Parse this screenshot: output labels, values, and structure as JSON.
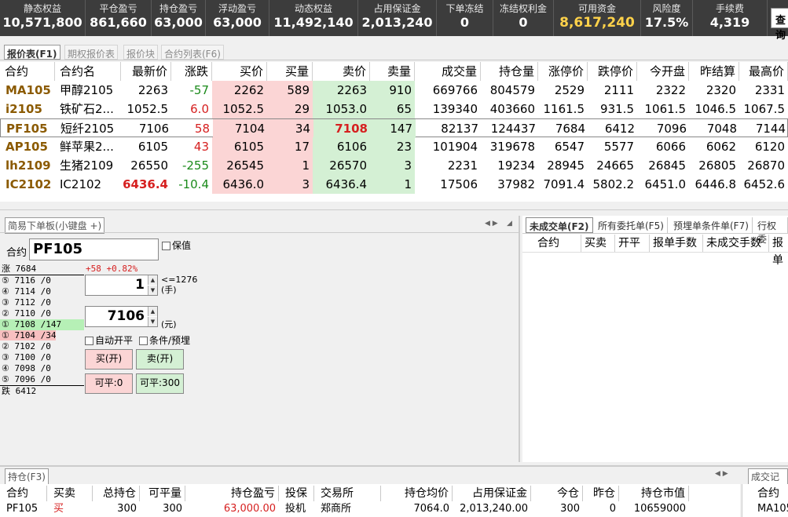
{
  "topbar": [
    {
      "label": "静态权益",
      "value": "10,571,800"
    },
    {
      "label": "平仓盈亏",
      "value": "861,660"
    },
    {
      "label": "持仓盈亏",
      "value": "63,000"
    },
    {
      "label": "浮动盈亏",
      "value": "63,000"
    },
    {
      "label": "动态权益",
      "value": "11,492,140"
    },
    {
      "label": "占用保证金",
      "value": "2,013,240"
    },
    {
      "label": "下单冻结",
      "value": "0"
    },
    {
      "label": "冻结权利金",
      "value": "0"
    },
    {
      "label": "可用资金",
      "value": "8,617,240"
    },
    {
      "label": "风险度",
      "value": "17.5%"
    },
    {
      "label": "手续费",
      "value": "4,319"
    }
  ],
  "query_button": "查询",
  "main_tabs": [
    "报价表(F1)",
    "期权报价表",
    "报价块",
    "合约列表(F6)"
  ],
  "quote": {
    "headers": [
      "合约",
      "合约名",
      "最新价",
      "涨跌",
      "买价",
      "买量",
      "卖价",
      "卖量",
      "成交量",
      "持仓量",
      "涨停价",
      "跌停价",
      "今开盘",
      "昨结算",
      "最高价"
    ],
    "rows": [
      [
        "MA105",
        "甲醇2105",
        "2263",
        "-57",
        "2262",
        "589",
        "2263",
        "910",
        "669766",
        "804579",
        "2529",
        "2111",
        "2322",
        "2320",
        "2331"
      ],
      [
        "i2105",
        "铁矿石2...",
        "1052.5",
        "6.0",
        "1052.5",
        "29",
        "1053.0",
        "65",
        "139340",
        "403660",
        "1161.5",
        "931.5",
        "1061.5",
        "1046.5",
        "1067.5"
      ],
      [
        "PF105",
        "短纤2105",
        "7106",
        "58",
        "7104",
        "34",
        "7108",
        "147",
        "82137",
        "124437",
        "7684",
        "6412",
        "7096",
        "7048",
        "7144"
      ],
      [
        "AP105",
        "鲜苹果2...",
        "6105",
        "43",
        "6105",
        "17",
        "6106",
        "23",
        "101904",
        "319678",
        "6547",
        "5577",
        "6066",
        "6062",
        "6120"
      ],
      [
        "lh2109",
        "生猪2109",
        "26550",
        "-255",
        "26545",
        "1",
        "26570",
        "3",
        "2231",
        "19234",
        "28945",
        "24665",
        "26845",
        "26805",
        "26870"
      ],
      [
        "IC2102",
        "IC2102",
        "6436.4",
        "-10.4",
        "6436.0",
        "3",
        "6436.4",
        "1",
        "17506",
        "37982",
        "7091.4",
        "5802.2",
        "6451.0",
        "6446.8",
        "6452.6"
      ]
    ]
  },
  "order": {
    "tab": "简易下单板(小键盘 +)",
    "contract_label": "合约",
    "contract_value": "PF105",
    "hedge_label": "保值",
    "change": "+58 +0.82%",
    "limit_up": "涨 7684",
    "limit_down": "跌 6412",
    "asks": [
      "⑤ 7116 /0",
      "④ 7114 /0",
      "③ 7112 /0",
      "② 7110 /0",
      "① 7108 /147"
    ],
    "bids": [
      "① 7104 /34",
      "② 7102 /0",
      "③ 7100 /0",
      "④ 7098 /0",
      "⑤ 7096 /0"
    ],
    "qty": "1",
    "qty_max": "<=1276",
    "qty_unit": "(手)",
    "price": "7106",
    "price_unit": "(元)",
    "auto_label": "自动开平",
    "cond_label": "条件/预埋",
    "buy_label": "买(开)",
    "sell_label": "卖(开)",
    "close_buy": "可平:0",
    "close_sell": "可平:300"
  },
  "right_tabs": [
    "未成交单(F2)",
    "所有委托单(F5)",
    "预埋单条件单(F7)",
    "行权委"
  ],
  "right_headers": [
    "合约",
    "买卖",
    "开平",
    "报单手数",
    "未成交手数",
    "报单"
  ],
  "positions": {
    "tab": "持仓(F3)",
    "headers": [
      "合约",
      "买卖",
      "总持仓",
      "可平量",
      "持仓盈亏",
      "投保",
      "交易所",
      "持仓均价",
      "占用保证金",
      "今仓",
      "昨仓",
      "持仓市值"
    ],
    "row": [
      "PF105",
      "买",
      "300",
      "300",
      "63,000.00",
      "投机",
      "郑商所",
      "7064.0",
      "2,013,240.00",
      "300",
      "0",
      "10659000"
    ]
  },
  "trades": {
    "tab": "成交记录",
    "header": "合约",
    "row": "MA105"
  },
  "colors": {
    "up": "#d62020",
    "down": "#1a8a1a",
    "bid_bg": "#fbd5d5",
    "ask_bg": "#d4f0d4",
    "available": "#ffd24a"
  }
}
